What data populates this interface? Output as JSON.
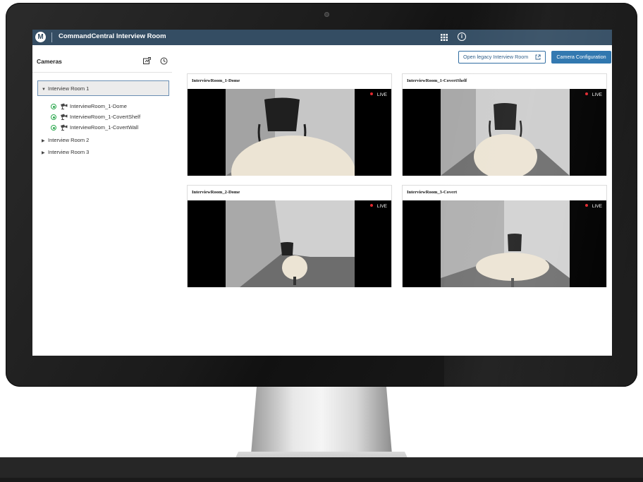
{
  "app": {
    "logo": "M",
    "title": "CommandCentral Interview Room"
  },
  "sidebar": {
    "title": "Cameras",
    "rooms": [
      {
        "label": "Interview Room 1",
        "expanded": true,
        "cameras": [
          {
            "label": "InterviewRoom_1-Dome",
            "status": "online"
          },
          {
            "label": "InterviewRoom_1-CovertShelf",
            "status": "online"
          },
          {
            "label": "InterviewRoom_1-CovertWall",
            "status": "online"
          }
        ]
      },
      {
        "label": "Interview Room 2",
        "expanded": false
      },
      {
        "label": "Interview Room 3",
        "expanded": false
      }
    ]
  },
  "toolbar": {
    "legacy_label": "Open legacy Interview Room",
    "config_label": "Camera Configuration"
  },
  "feeds": [
    {
      "title": "InterviewRoom_1-Dome",
      "live_label": "LIVE"
    },
    {
      "title": "InterviewRoom_1-CovertShelf",
      "live_label": "LIVE"
    },
    {
      "title": "InterviewRoom_2-Dome",
      "live_label": "LIVE"
    },
    {
      "title": "InterviewRoom_3-Covert",
      "live_label": "LIVE"
    }
  ],
  "colors": {
    "header": "#344d63",
    "accent": "#2a73ad",
    "status_online": "#2da84f",
    "live_dot": "#e0282e"
  },
  "icons": {
    "logo": "motorola-logo-icon",
    "apps": "apps-grid-icon",
    "info": "info-icon",
    "export": "export-icon",
    "history": "history-icon",
    "camera": "camera-icon",
    "external": "external-link-icon"
  }
}
